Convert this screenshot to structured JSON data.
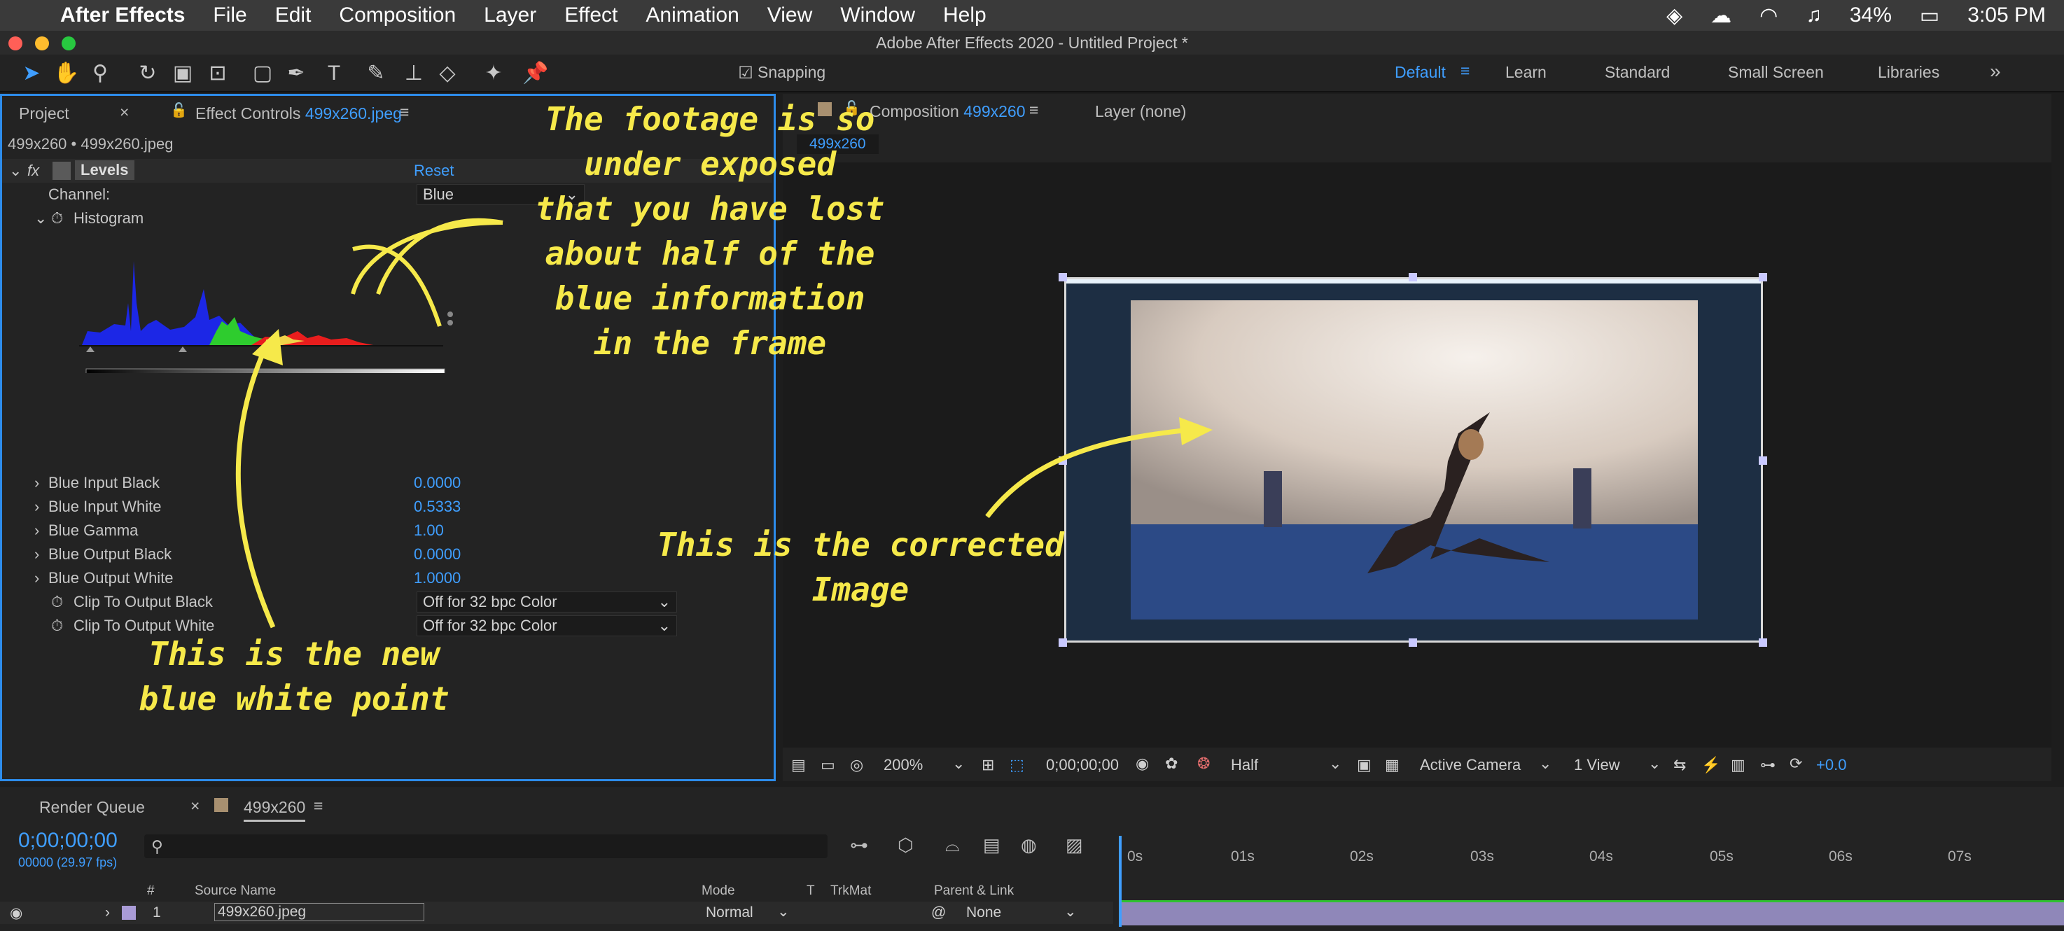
{
  "menubar": {
    "app": "After Effects",
    "items": [
      "File",
      "Edit",
      "Composition",
      "Layer",
      "Effect",
      "Animation",
      "View",
      "Window",
      "Help"
    ],
    "battery": "34%",
    "clock": "3:05 PM"
  },
  "window": {
    "title": "Adobe After Effects 2020 - Untitled Project *"
  },
  "toolbar": {
    "snapping": "Snapping",
    "workspaces": [
      "Default",
      "Learn",
      "Standard",
      "Small Screen",
      "Libraries"
    ]
  },
  "project_panel": {
    "tab_project": "Project",
    "tab_effect": "Effect Controls",
    "effect_file": "499x260.jpeg",
    "breadcrumb": "499x260 • 499x260.jpeg",
    "effect_name": "Levels",
    "reset": "Reset",
    "channel_label": "Channel:",
    "channel_value": "Blue",
    "histogram_label": "Histogram",
    "params": [
      {
        "label": "Blue Input Black",
        "value": "0.0000"
      },
      {
        "label": "Blue Input White",
        "value": "0.5333"
      },
      {
        "label": "Blue Gamma",
        "value": "1.00"
      },
      {
        "label": "Blue Output Black",
        "value": "0.0000"
      },
      {
        "label": "Blue Output White",
        "value": "1.0000"
      }
    ],
    "clip_black": {
      "label": "Clip To Output Black",
      "value": "Off for 32 bpc Color"
    },
    "clip_white": {
      "label": "Clip To Output White",
      "value": "Off for 32 bpc Color"
    }
  },
  "comp_panel": {
    "tab_comp": "Composition",
    "comp_name": "499x260",
    "layer_tab": "Layer (none)",
    "comp_chip": "499x260",
    "zoom": "200%",
    "timecode": "0;00;00;00",
    "resolution": "Half",
    "camera": "Active Camera",
    "view": "1 View",
    "exposure": "+0.0"
  },
  "annotations": {
    "footage": "The footage is so\nunder exposed\nthat you have lost\nabout half of the\nblue information\nin the frame",
    "corrected": "This is the corrected\nImage",
    "white_point": "This is the new\nblue white point"
  },
  "timeline": {
    "render_queue": "Render Queue",
    "comp_tab": "499x260",
    "timecode": "0;00;00;00",
    "frames": "00000 (29.97 fps)",
    "cols": {
      "num": "#",
      "source": "Source Name",
      "mode": "Mode",
      "t": "T",
      "trkmat": "TrkMat",
      "parent": "Parent & Link"
    },
    "layer": {
      "num": "1",
      "name": "499x260.jpeg",
      "mode": "Normal",
      "parent": "None"
    },
    "ruler": [
      "0s",
      "01s",
      "02s",
      "03s",
      "04s",
      "05s",
      "06s",
      "07s"
    ]
  }
}
